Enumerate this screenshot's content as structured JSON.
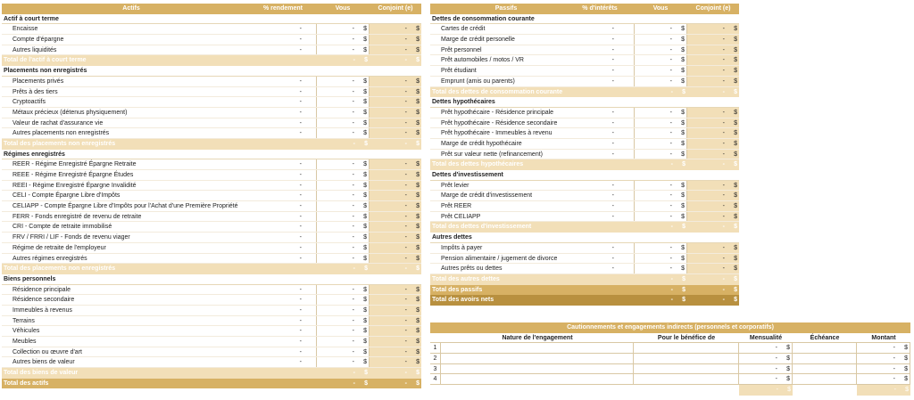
{
  "actifs": {
    "headers": {
      "label": "Actifs",
      "pct": "% rendement",
      "vous": "Vous",
      "conjoint": "Conjoint (e)"
    },
    "sections": [
      {
        "title": "Actif à court terme",
        "items": [
          "Encaisse",
          "Compte d'épargne",
          "Autres liquidités"
        ],
        "total": "Total de l'actif à court terme"
      },
      {
        "title": "Placements non enregistrés",
        "items": [
          "Placements privés",
          "Prêts à des tiers",
          "Cryptoactifs",
          "Métaux précieux (détenus physiquement)",
          "Valeur de rachat d'assurance vie",
          "Autres placements non enregistrés"
        ],
        "total": "Total des placements non enregistrés"
      },
      {
        "title": "Régimes enregistrés",
        "items": [
          "REER - Régime Enregistré Épargne Retraite",
          "REEE - Régime Enregistré Épargne Études",
          "REEI - Régime Enregistré Épargne Invalidité",
          "CELI - Compte Épargne Libre d'Impôts",
          "CELIAPP - Compte Épargne Libre d'Impôts pour l'Achat d'une Première Propriété",
          "FERR - Fonds enregistré de revenu de retraite",
          "CRI - Compte de retraite immobilisé",
          "FRV / FRRI / LIF - Fonds de revenu viager",
          "Régime de retraite de l'employeur",
          "Autres régimes enregistrés"
        ],
        "total": "Total des placements non enregistrés"
      },
      {
        "title": "Biens personnels",
        "items": [
          "Résidence principale",
          "Résidence secondaire",
          "Immeubles à revenus",
          "Terrains",
          "Véhicules",
          "Meubles",
          "Collection ou œuvre d'art",
          "Autres biens de valeur"
        ],
        "total": "Total des biens de valeur"
      }
    ],
    "grand_total": "Total des actifs"
  },
  "passifs": {
    "headers": {
      "label": "Passifs",
      "pct": "% d'intérêts",
      "vous": "Vous",
      "conjoint": "Conjoint (e)"
    },
    "sections": [
      {
        "title": "Dettes de consommation courante",
        "items": [
          "Cartes de crédit",
          "Marge de crédit personelle",
          "Prêt personnel",
          "Prêt automobiles / motos / VR",
          "Prêt étudiant",
          "Emprunt (amis ou parents)"
        ],
        "total": "Total des dettes de consommation courante"
      },
      {
        "title": "Dettes hypothécaires",
        "items": [
          "Prêt hypothécaire - Résidence principale",
          "Prêt hypothécaire - Résidence secondaire",
          "Prêt hypothécaire - Immeubles à revenu",
          "Marge de crédit hypothécaire",
          "Prêt sur valeur nette (refinancement)"
        ],
        "total": "Total des dettes hypothécaires"
      },
      {
        "title": "Dettes d'investissement",
        "items": [
          "Prêt levier",
          "Marge de crédit d'investissement",
          "Prêt REER",
          "Prêt CELIAPP"
        ],
        "total": "Total des dettes d'investissement"
      },
      {
        "title": "Autres dettes",
        "items": [
          "Impôts à payer",
          "Pension alimentaire / jugement de divorce",
          "Autres prêts ou dettes"
        ],
        "total": "Total des autres dettes"
      }
    ],
    "grand_total": "Total des passifs",
    "net": "Total des avoirs nets"
  },
  "values": {
    "dash": "-",
    "dollar": "$"
  },
  "cautionnements": {
    "title": "Cautionnements et engagements indirects (personnels et corporatifs)",
    "headers": {
      "nature": "Nature de l'engagement",
      "benefice": "Pour le bénéfice de",
      "mensualite": "Mensualité",
      "echeance": "Échéance",
      "montant": "Montant"
    },
    "rows": [
      "1",
      "2",
      "3",
      "4"
    ]
  },
  "colors": {
    "gold": "#d7b164",
    "light": "#f2dfb8",
    "dark": "#b8903f"
  }
}
